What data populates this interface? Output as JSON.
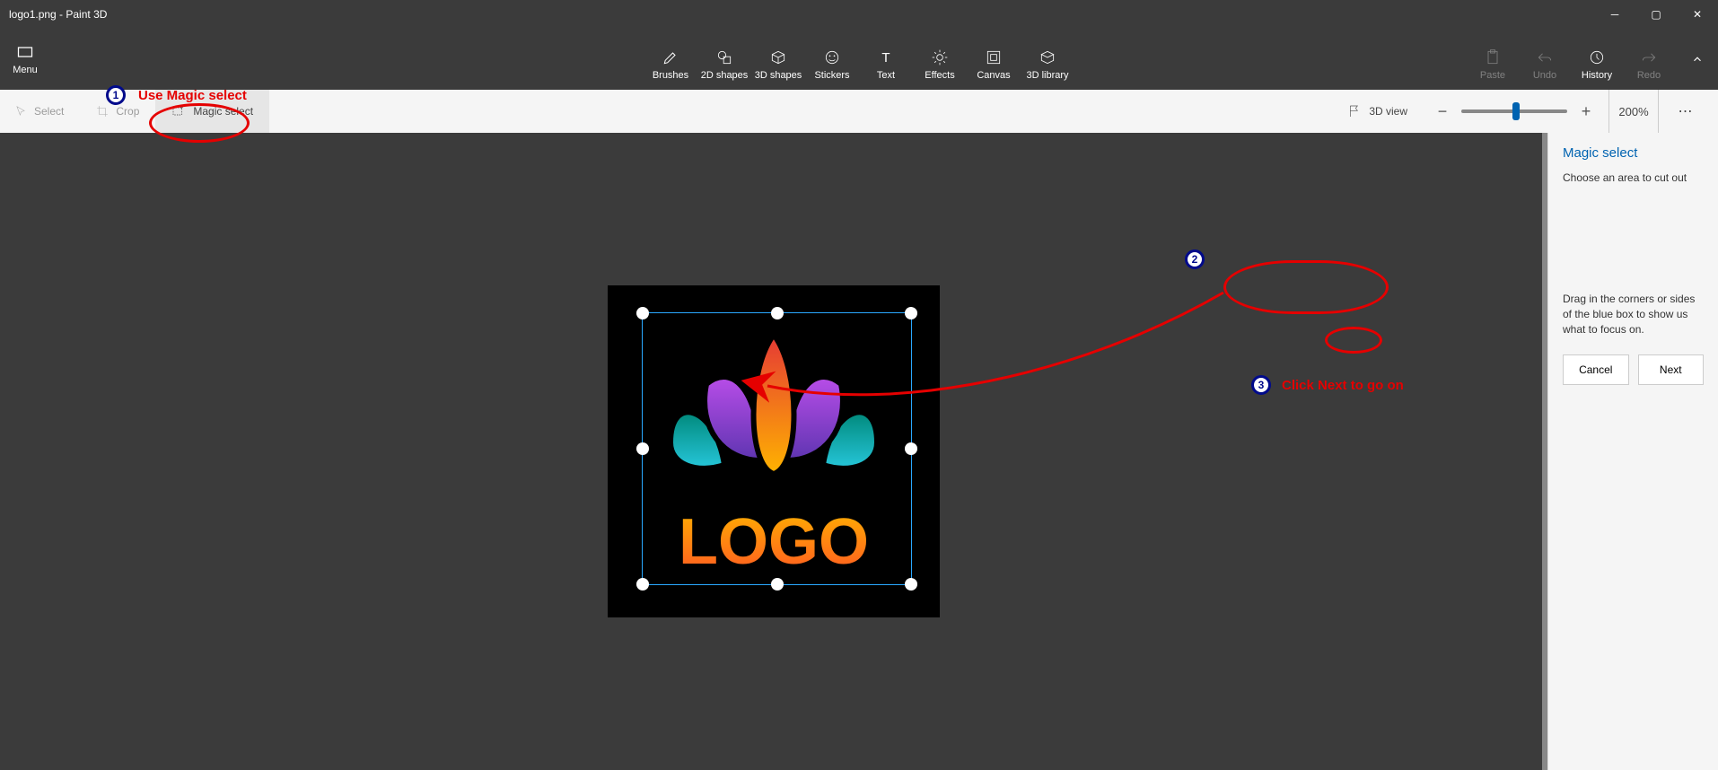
{
  "title": "logo1.png - Paint 3D",
  "menu_label": "Menu",
  "ribbon": {
    "brushes": "Brushes",
    "shapes2d": "2D shapes",
    "shapes3d": "3D shapes",
    "stickers": "Stickers",
    "text": "Text",
    "effects": "Effects",
    "canvas": "Canvas",
    "library3d": "3D library",
    "paste": "Paste",
    "undo": "Undo",
    "history": "History",
    "redo": "Redo"
  },
  "subbar": {
    "select": "Select",
    "crop": "Crop",
    "magic_select": "Magic select",
    "view3d": "3D view",
    "zoom": "200%"
  },
  "panel": {
    "title": "Magic select",
    "sub": "Choose an area to cut out",
    "hint": "Drag in the corners or sides of the blue box to show us what to focus on.",
    "cancel": "Cancel",
    "next": "Next"
  },
  "annotations": {
    "a1": "Use Magic select",
    "a3": "Click Next to go on"
  },
  "logo_text": "LOGO"
}
